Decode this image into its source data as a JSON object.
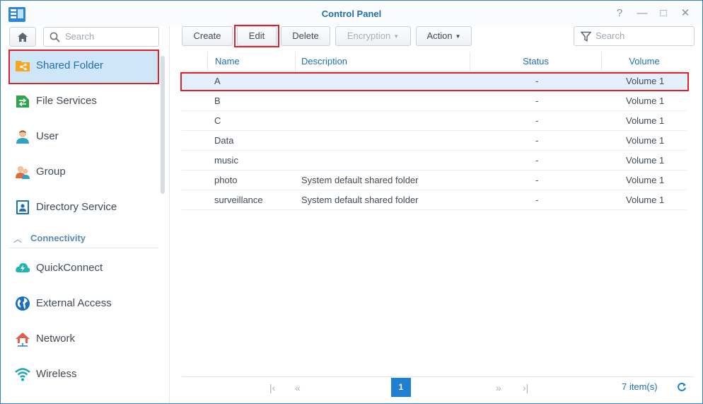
{
  "window": {
    "title": "Control Panel",
    "controls": [
      "?",
      "—",
      "□",
      "✕"
    ]
  },
  "sidebar": {
    "search_placeholder": "Search",
    "items": [
      {
        "label": "Shared Folder",
        "icon": "shared-folder-icon"
      },
      {
        "label": "File Services",
        "icon": "file-services-icon"
      },
      {
        "label": "User",
        "icon": "user-icon"
      },
      {
        "label": "Group",
        "icon": "group-icon"
      },
      {
        "label": "Directory Service",
        "icon": "directory-service-icon"
      }
    ],
    "section": "Connectivity",
    "connectivity_items": [
      {
        "label": "QuickConnect",
        "icon": "quickconnect-icon"
      },
      {
        "label": "External Access",
        "icon": "external-access-icon"
      },
      {
        "label": "Network",
        "icon": "network-icon"
      },
      {
        "label": "Wireless",
        "icon": "wireless-icon"
      }
    ]
  },
  "toolbar": {
    "create": "Create",
    "edit": "Edit",
    "delete": "Delete",
    "encryption": "Encryption",
    "action": "Action",
    "search_placeholder": "Search"
  },
  "grid": {
    "columns": [
      "Name",
      "Description",
      "Status",
      "Volume"
    ],
    "rows": [
      {
        "name": "A",
        "description": "",
        "status": "-",
        "volume": "Volume 1"
      },
      {
        "name": "B",
        "description": "",
        "status": "-",
        "volume": "Volume 1"
      },
      {
        "name": "C",
        "description": "",
        "status": "-",
        "volume": "Volume 1"
      },
      {
        "name": "Data",
        "description": "",
        "status": "-",
        "volume": "Volume 1"
      },
      {
        "name": "music",
        "description": "",
        "status": "-",
        "volume": "Volume 1"
      },
      {
        "name": "photo",
        "description": "System default shared folder",
        "status": "-",
        "volume": "Volume 1"
      },
      {
        "name": "surveillance",
        "description": "System default shared folder",
        "status": "-",
        "volume": "Volume 1"
      }
    ]
  },
  "pager": {
    "current_page": "1",
    "item_count": "7 item(s)"
  },
  "colors": {
    "accent": "#1f6fb2",
    "selected_row": "#e3f0fb",
    "active_nav": "#cfe6f8",
    "highlight_box": "#e0202a"
  }
}
